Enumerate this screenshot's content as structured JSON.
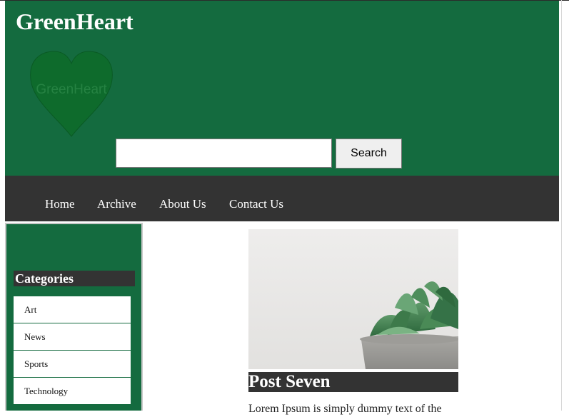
{
  "site": {
    "title": "GreenHeart",
    "logo_text": "GreenHeart"
  },
  "search": {
    "value": "",
    "placeholder": "",
    "button_label": "Search"
  },
  "nav": {
    "items": [
      {
        "label": "Home"
      },
      {
        "label": "Archive"
      },
      {
        "label": "About Us"
      },
      {
        "label": "Contact Us"
      }
    ]
  },
  "sidebar": {
    "heading": "Categories",
    "categories": [
      {
        "label": "Art"
      },
      {
        "label": "News"
      },
      {
        "label": "Sports"
      },
      {
        "label": "Technology"
      }
    ]
  },
  "post": {
    "title": "Post Seven",
    "excerpt": "Lorem Ipsum is simply dummy text of the"
  },
  "colors": {
    "header_bg": "#146b3f",
    "nav_bg": "#333333",
    "logo_heart": "#0e6b2c"
  }
}
